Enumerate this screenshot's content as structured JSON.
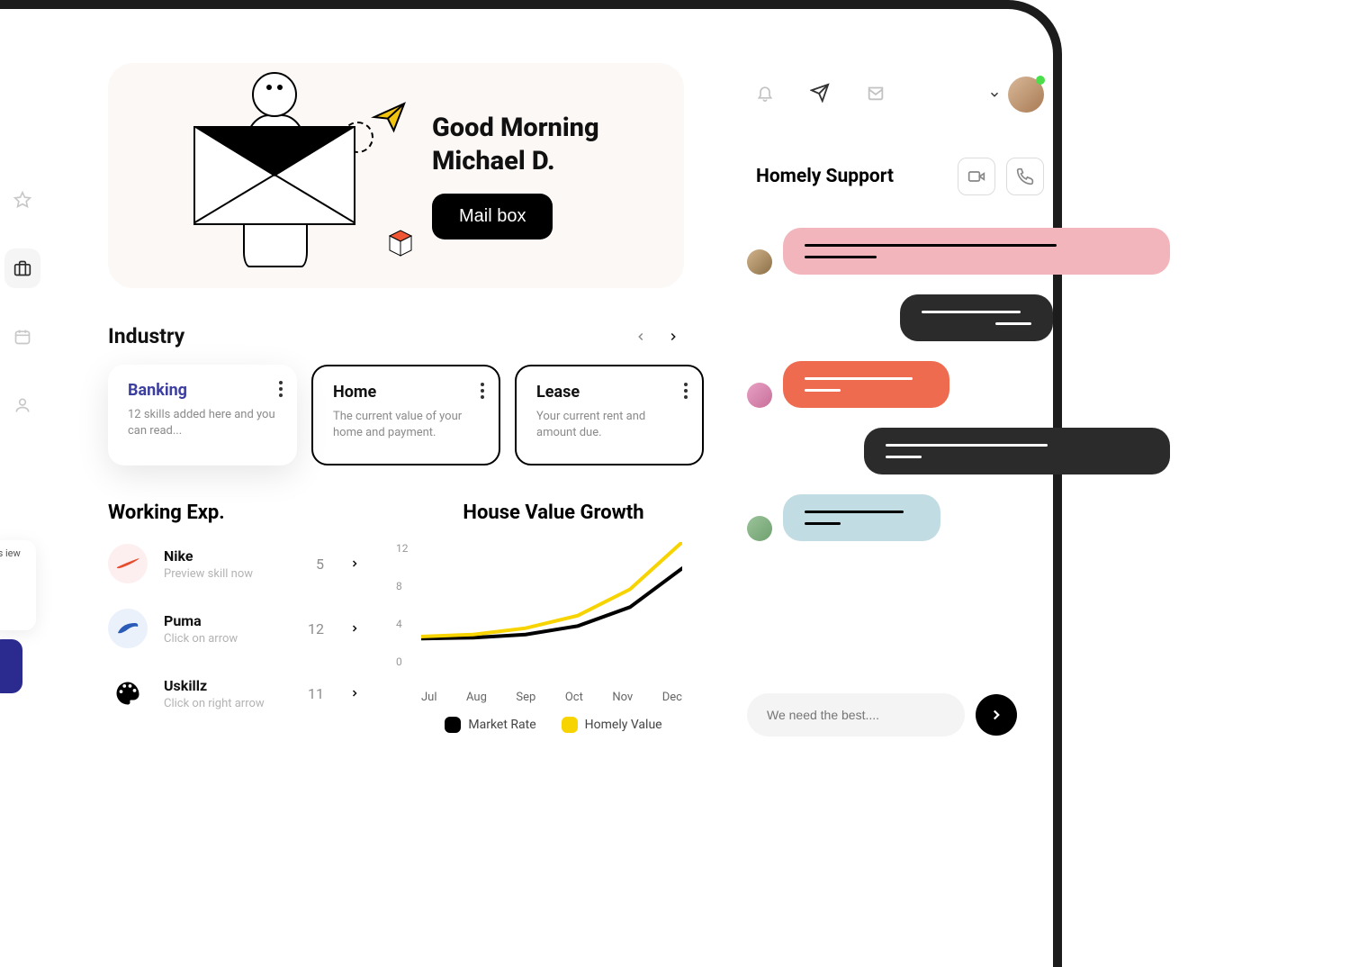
{
  "hero": {
    "greeting_1": "Good Morning",
    "greeting_2": "Michael D.",
    "button": "Mail box"
  },
  "industry": {
    "title": "Industry",
    "cards": [
      {
        "title": "Banking",
        "desc": "12 skills added here and you can read..."
      },
      {
        "title": "Home",
        "desc": "The current value of your home and payment."
      },
      {
        "title": "Lease",
        "desc": "Your current rent and amount due."
      }
    ]
  },
  "working": {
    "title": "Working Exp.",
    "items": [
      {
        "name": "Nike",
        "sub": "Preview skill now",
        "count": "5"
      },
      {
        "name": "Puma",
        "sub": "Click on arrow",
        "count": "12"
      },
      {
        "name": "Uskillz",
        "sub": "Click on right arrow",
        "count": "11"
      }
    ]
  },
  "chart": {
    "title": "House Value Growth",
    "legend": {
      "a": "Market Rate",
      "b": "Homely Value"
    }
  },
  "chart_data": {
    "type": "line",
    "x": [
      "Jul",
      "Aug",
      "Sep",
      "Oct",
      "Nov",
      "Dec"
    ],
    "ylim": [
      0,
      12
    ],
    "yticks": [
      0,
      4,
      8,
      12
    ],
    "series": [
      {
        "name": "Market Rate",
        "color": "#000000",
        "values": [
          2.8,
          2.9,
          3.2,
          4.0,
          5.8,
          9.5
        ]
      },
      {
        "name": "Homely Value",
        "color": "#f7d400",
        "values": [
          3.0,
          3.2,
          3.8,
          5.0,
          7.5,
          12.0
        ]
      }
    ],
    "title": "House Value Growth",
    "xlabel": "",
    "ylabel": ""
  },
  "chat": {
    "title": "Homely Support",
    "input_placeholder": "We need the best...."
  },
  "sidebar_card": "’s iew",
  "colors": {
    "pink": "#f1b5bb",
    "dark": "#2b2b2b",
    "orange": "#ef6b4f",
    "blue": "#c2dce4",
    "yellow": "#f7d400"
  }
}
